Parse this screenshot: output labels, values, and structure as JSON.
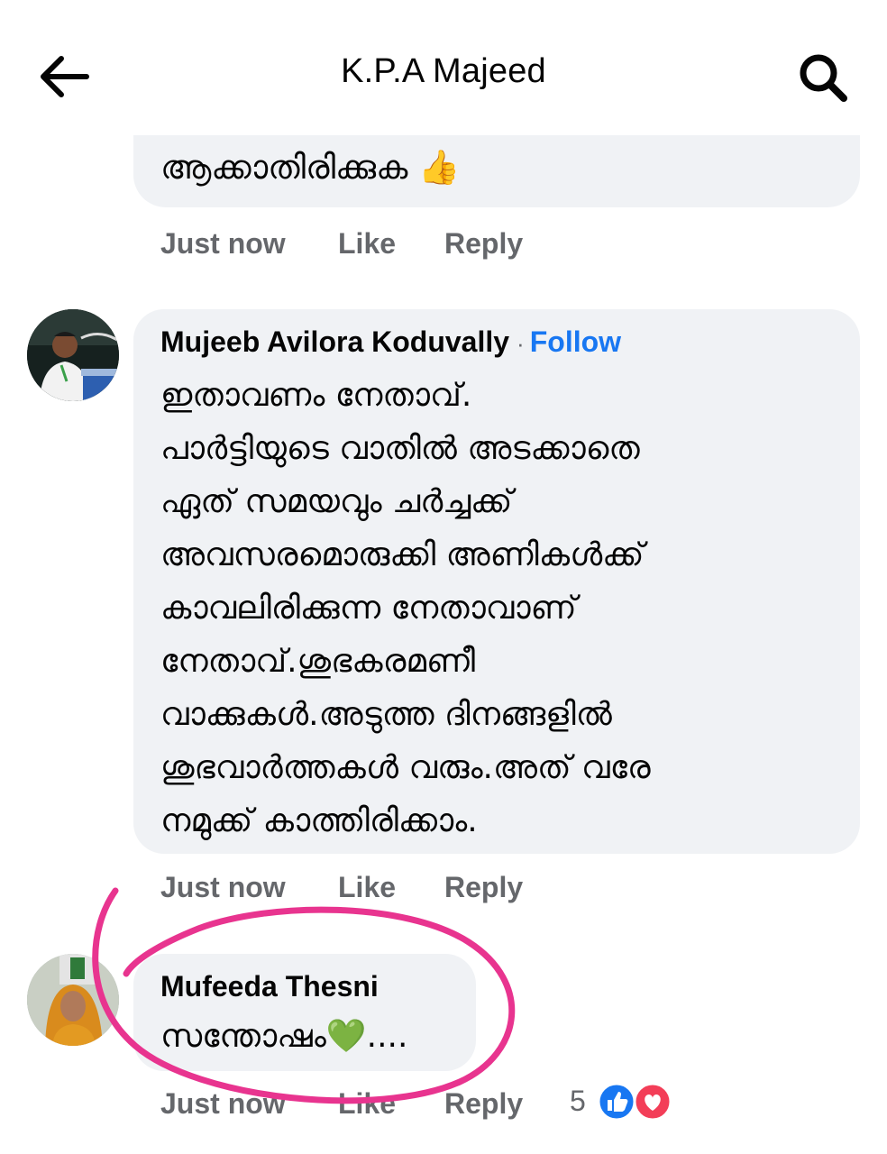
{
  "header": {
    "title": "K.P.A Majeed"
  },
  "comments": [
    {
      "text": "ആക്കാതിരിക്കുക 👍",
      "meta": {
        "time": "Just now",
        "like": "Like",
        "reply": "Reply"
      }
    },
    {
      "author": "Mujeeb Avilora Koduvally",
      "separator": "·",
      "follow": "Follow",
      "text": "ഇതാവണം നേതാവ്.\nപാർട്ടിയുടെ വാതിൽ അടക്കാതെ\nഏത് സമയവും ചർച്ചക്ക്\nഅവസരമൊരുക്കി അണികൾക്ക്\nകാവലിരിക്കുന്ന നേതാവാണ്\nനേതാവ്.ശുഭകരമണീ\nവാക്കുകൾ.അടുത്ത ദിനങ്ങളിൽ\nശുഭവാർത്തകൾ വരും.അത് വരേ\nനമുക്ക് കാത്തിരിക്കാം.",
      "meta": {
        "time": "Just now",
        "like": "Like",
        "reply": "Reply"
      }
    },
    {
      "author": "Mufeeda Thesni",
      "text": "സന്തോഷം💚....",
      "meta": {
        "time": "Just now",
        "like": "Like",
        "reply": "Reply"
      },
      "reaction_count": "5",
      "reactions": [
        "like-reaction-icon",
        "love-reaction-icon"
      ]
    }
  ],
  "colors": {
    "link": "#1877f2",
    "bubble": "#f0f2f5",
    "meta": "#65676b",
    "annotation": "#e8348f"
  }
}
